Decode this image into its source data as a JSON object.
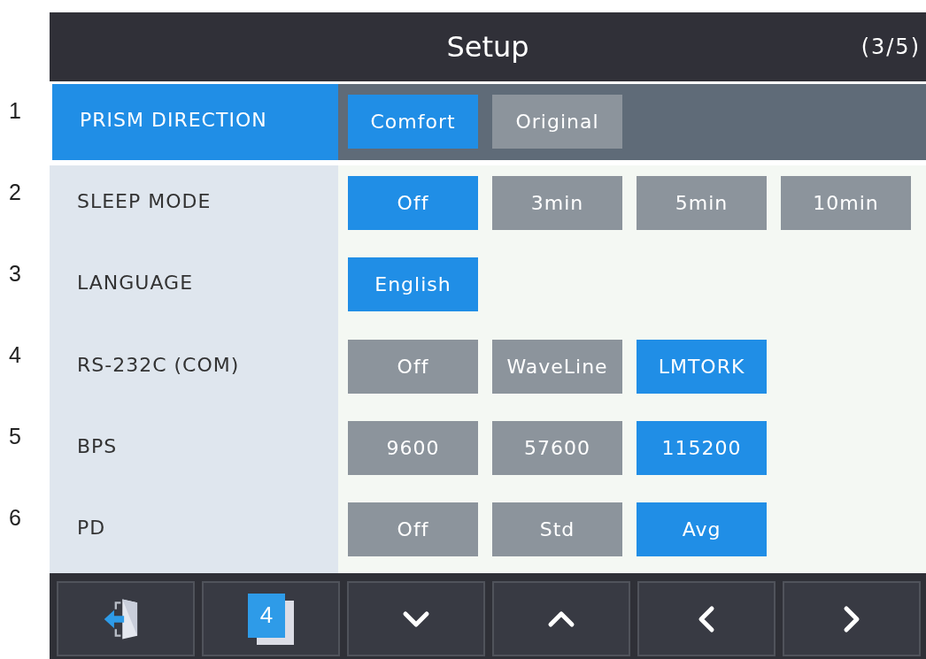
{
  "header": {
    "title": "Setup",
    "page": "(3/5)"
  },
  "rows": [
    {
      "number": "1",
      "label": "PRISM DIRECTION",
      "selected": true,
      "options": [
        {
          "label": "Comfort",
          "selected": true
        },
        {
          "label": "Original",
          "selected": false
        }
      ]
    },
    {
      "number": "2",
      "label": "SLEEP MODE",
      "selected": false,
      "options": [
        {
          "label": "Off",
          "selected": true
        },
        {
          "label": "3min",
          "selected": false
        },
        {
          "label": "5min",
          "selected": false
        },
        {
          "label": "10min",
          "selected": false
        }
      ]
    },
    {
      "number": "3",
      "label": "LANGUAGE",
      "selected": false,
      "options": [
        {
          "label": "English",
          "selected": true
        }
      ]
    },
    {
      "number": "4",
      "label": "RS-232C (COM)",
      "selected": false,
      "options": [
        {
          "label": "Off",
          "selected": false
        },
        {
          "label": "WaveLine",
          "selected": false
        },
        {
          "label": "LMTORK",
          "selected": true
        }
      ]
    },
    {
      "number": "5",
      "label": "BPS",
      "selected": false,
      "options": [
        {
          "label": "9600",
          "selected": false
        },
        {
          "label": "57600",
          "selected": false
        },
        {
          "label": "115200",
          "selected": true
        }
      ]
    },
    {
      "number": "6",
      "label": "PD",
      "selected": false,
      "options": [
        {
          "label": "Off",
          "selected": false
        },
        {
          "label": "Std",
          "selected": false
        },
        {
          "label": "Avg",
          "selected": true
        }
      ]
    }
  ],
  "toolbar": [
    {
      "kind": "exit"
    },
    {
      "kind": "page",
      "label": "4"
    },
    {
      "kind": "down"
    },
    {
      "kind": "up"
    },
    {
      "kind": "left"
    },
    {
      "kind": "right"
    }
  ]
}
